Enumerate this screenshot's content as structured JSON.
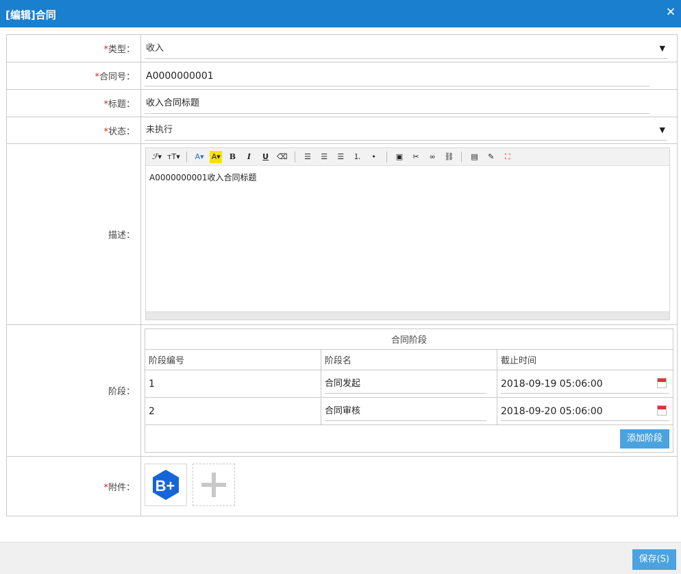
{
  "window": {
    "title": "[编辑]合同",
    "close_symbol": "✕"
  },
  "form": {
    "required_mark": "*",
    "type": {
      "label": "类型：",
      "value": "收入"
    },
    "contract_no": {
      "label": "合同号：",
      "value": "A0000000001"
    },
    "title": {
      "label": "标题：",
      "value": "收入合同标题"
    },
    "status": {
      "label": "状态：",
      "value": "未执行"
    },
    "description": {
      "label": "描述：",
      "value": "A0000000001收入合同标题"
    },
    "stages": {
      "label": "阶段：",
      "caption": "合同阶段",
      "columns": [
        "阶段编号",
        "阶段名",
        "截止时间"
      ],
      "rows": [
        {
          "no": "1",
          "name": "合同发起",
          "deadline": "2018-09-19 05:06:00"
        },
        {
          "no": "2",
          "name": "合同审核",
          "deadline": "2018-09-20 05:06:00"
        }
      ],
      "add_button": "添加阶段"
    },
    "attachment": {
      "label": "附件：",
      "file_icon_text": "B+"
    }
  },
  "editor_toolbar": {
    "font_family": "ℱ▾",
    "font_size": "тT▾",
    "font_color": "A▾",
    "bg_color": "A▾",
    "bold": "B",
    "italic": "I",
    "underline": "U"
  },
  "footer": {
    "save_label": "保存(S)"
  },
  "colors": {
    "titlebar": "#1a7fce",
    "button": "#4aa3df",
    "required": "#e02020"
  }
}
